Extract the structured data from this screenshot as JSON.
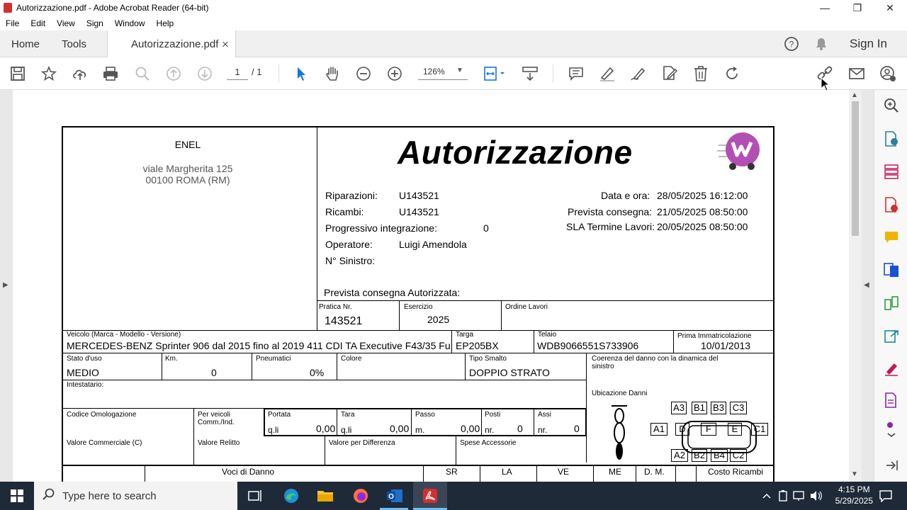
{
  "window": {
    "title": "Autorizzazione.pdf - Adobe Acrobat Reader (64-bit)",
    "minimize": "—",
    "maximize": "❐",
    "close": "✕"
  },
  "menu": [
    "File",
    "Edit",
    "View",
    "Sign",
    "Window",
    "Help"
  ],
  "tabs": {
    "home": "Home",
    "tools": "Tools",
    "doc": "Autorizzazione.pdf",
    "doc_close": "×",
    "sign_in": "Sign In"
  },
  "toolbar": {
    "page_current": "1",
    "page_total": "/ 1",
    "zoom": "126%"
  },
  "document": {
    "company": "ENEL",
    "address1": "viale Margherita 125",
    "address2": "00100 ROMA (RM)",
    "title": "Autorizzazione",
    "riparazioni_label": "Riparazioni:",
    "riparazioni_val": "U143521",
    "ricambi_label": "Ricambi:",
    "ricambi_val": "U143521",
    "progressivo_label": "Progressivo integrazione:",
    "progressivo_val": "0",
    "operatore_label": "Operatore:",
    "operatore_val": "Luigi Amendola",
    "sinistro_label": "N° Sinistro:",
    "data_ora_label": "Data e ora:",
    "data_ora_val": "28/05/2025  16:12:00",
    "prevista_label": "Prevista consegna:",
    "prevista_val": "21/05/2025  08:50:00",
    "sla_label": "SLA Termine Lavori:",
    "sla_val": "20/05/2025  08:50:00",
    "prevista_aut_label": "Prevista consegna Autorizzata:",
    "pratica_label": "Pratica Nr.",
    "pratica_val": "143521",
    "esercizio_label": "Esercizio",
    "esercizio_val": "2025",
    "ordine_label": "Ordine Lavori",
    "veicolo_label": "Veicolo (Marca - Modello - Versione)",
    "veicolo_val": "MERCEDES-BENZ  Sprinter 906 dal 2015 fino al 2019  411 CDI TA Executive F43/35 Fu",
    "targa_label": "Targa",
    "targa_val": "EP205BX",
    "telaio_label": "Telaio",
    "telaio_val": "WDB9066551S733906",
    "immatricolazione_label": "Prima Immatricolazione",
    "immatricolazione_val": "10/01/2013",
    "stato_label": "Stato d'uso",
    "stato_val": "MEDIO",
    "km_label": "Km.",
    "km_val": "0",
    "pneumatici_label": "Pneumatici",
    "pneumatici_val": "0%",
    "colore_label": "Colore",
    "smalto_label": "Tipo Smalto",
    "smalto_val": "DOPPIO STRATO",
    "coerenza_label": "Coerenza del danno con la dinamica del sinistro",
    "intestatario_label": "Intestatario:",
    "ubicazione_label": "Ubicazione Danni",
    "omologazione_label": "Codice Omologazione",
    "perveicoli_label": "Per veicoli Comm./Ind.",
    "portata_label": "Portata",
    "portata_unit": "q.li",
    "portata_val": "0,00",
    "tara_label": "Tara",
    "tara_unit": "q.li",
    "tara_val": "0,00",
    "passo_label": "Passo",
    "passo_unit": "m.",
    "passo_val": "0,00",
    "posti_label": "Posti",
    "posti_unit": "nr.",
    "posti_val": "0",
    "assi_label": "Assi",
    "assi_unit": "nr.",
    "assi_val": "0",
    "valcomm_label": "Valore Commerciale (C)",
    "relitto_label": "Valore Relitto",
    "differenza_label": "Valore per Differenza",
    "accessorie_label": "Spese Accessorie",
    "voci_label": "Voci di Danno",
    "sr": "SR",
    "la": "LA",
    "ve": "VE",
    "me": "ME",
    "dm": "D. M.",
    "costo_label": "Costo Ricambi",
    "damage_boxes": [
      "A3",
      "B1",
      "B3",
      "C3",
      "A1",
      "D",
      "F",
      "E",
      "C1",
      "A2",
      "B2",
      "B4",
      "C2"
    ]
  },
  "taskbar": {
    "search_placeholder": "Type here to search",
    "time": "4:15 PM",
    "date": "5/29/2025"
  },
  "colors": {
    "accent": "#1473e6",
    "acrobat_red": "#d32f2f",
    "taskbar": "#1e2a38"
  }
}
